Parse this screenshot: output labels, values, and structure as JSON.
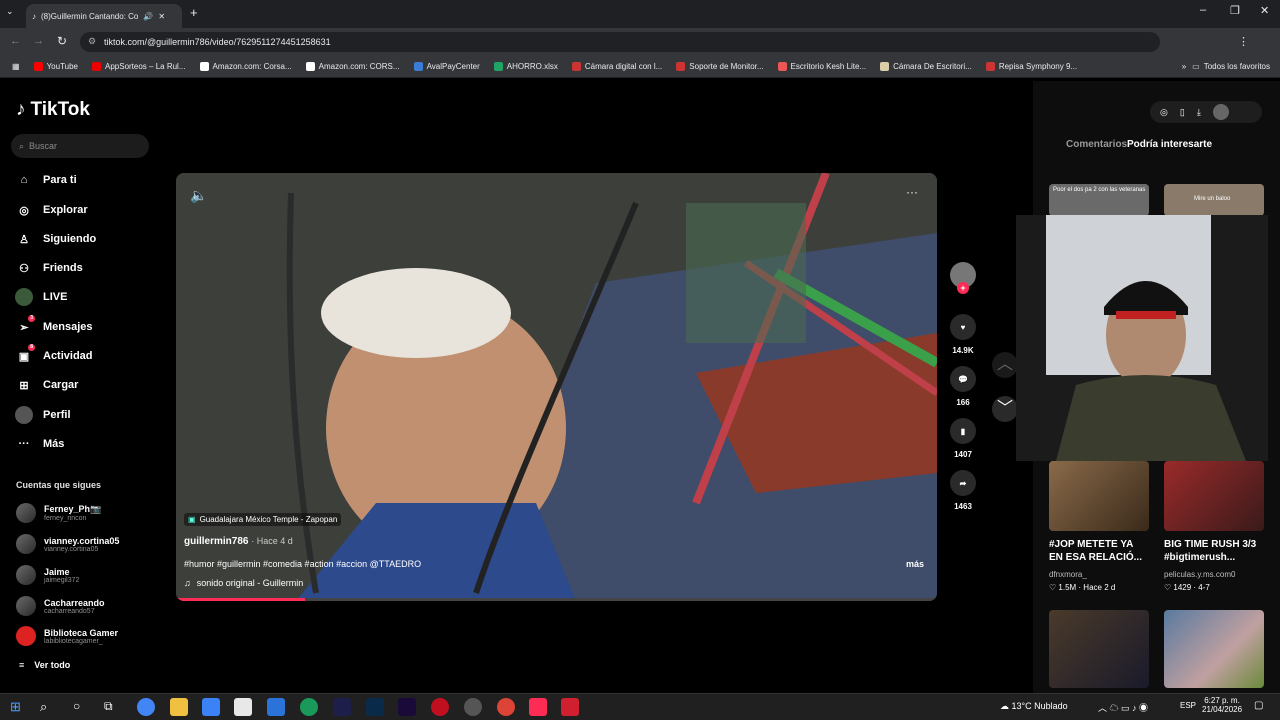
{
  "browser": {
    "tab_title": "(8)Guillermin Cantando: Co",
    "url": "tiktok.com/@guillermin786/video/7629511274451258631",
    "bookmarks": [
      "YouTube",
      "AppSorteos – La Rul...",
      "Amazon.com: Corsa...",
      "Amazon.com: CORS...",
      "AvalPayCenter",
      "AHORRO.xlsx",
      "Cámara digital con l...",
      "Soporte de Monitor...",
      "Escritorio Kesh Lite...",
      "Cámara De Escritori...",
      "Repisa Symphony 9..."
    ],
    "all_favorites": "Todos los favoritos"
  },
  "sidebar": {
    "logo": "TikTok",
    "search_placeholder": "Buscar",
    "nav": [
      {
        "label": "Para ti",
        "icon": "home-icon"
      },
      {
        "label": "Explorar",
        "icon": "compass-icon"
      },
      {
        "label": "Siguiendo",
        "icon": "following-icon"
      },
      {
        "label": "Friends",
        "icon": "friends-icon"
      },
      {
        "label": "LIVE",
        "icon": "live-icon"
      },
      {
        "label": "Mensajes",
        "icon": "messages-icon",
        "badge": "3"
      },
      {
        "label": "Actividad",
        "icon": "activity-icon",
        "badge": "8"
      },
      {
        "label": "Cargar",
        "icon": "upload-icon"
      },
      {
        "label": "Perfil",
        "icon": "profile-icon"
      },
      {
        "label": "Más",
        "icon": "more-icon"
      }
    ],
    "following_header": "Cuentas que sigues",
    "accounts": [
      {
        "name": "Ferney_Ph📷",
        "user": "ferney_rincon"
      },
      {
        "name": "vianney.cortina05",
        "user": "vianney.cortina05"
      },
      {
        "name": "Jaime",
        "user": "jaimegil372"
      },
      {
        "name": "Cacharreando",
        "user": "cacharreando57"
      },
      {
        "name": "Biblioteca Gamer",
        "user": "labibliotecagamer_"
      }
    ],
    "see_all": "Ver todo"
  },
  "video": {
    "location": "Guadalajara México Temple - Zapopan",
    "author": "guillermin786",
    "time": "· Hace 4 d",
    "caption": "#humor #guillermin #comedia #action #accion @TTAEDRO",
    "more": "más",
    "sound": "sonido original - Guillermin",
    "progress": 0.17
  },
  "actions": {
    "likes": "14.9K",
    "comments": "166",
    "saves": "1407",
    "shares": "1463"
  },
  "right_panel": {
    "tab_comments": "Comentarios",
    "tab_interest": "Podría interesarte",
    "top_tiles": [
      "Poor el dos pa 2 con las veteranas",
      "Mire un baloo"
    ],
    "cards": [
      {
        "title": "#JOP METETE YA EN ESA RELACIÓ...",
        "author": "dfnxmora_",
        "likes": "♡ 1.5M · Hace 2 d"
      },
      {
        "title": "BIG TIME RUSH 3/3 #bigtimerush...",
        "author": "peliculas.y.ms.com0",
        "likes": "♡ 1429 · 4-7"
      }
    ]
  },
  "taskbar": {
    "weather": "13°C  Nublado",
    "lang": "ESP",
    "time": "6:27 p. m.",
    "date": "21/04/2026"
  }
}
